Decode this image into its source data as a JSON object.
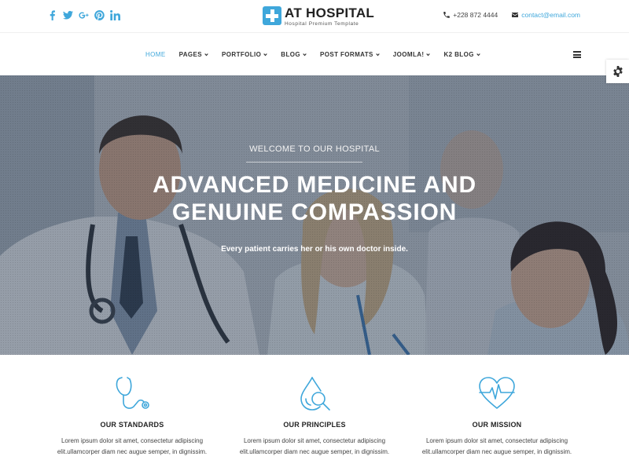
{
  "social": [
    "facebook-icon",
    "twitter-icon",
    "google-plus-icon",
    "pinterest-icon",
    "linkedin-icon"
  ],
  "logo": {
    "title": "AT HOSPITAL",
    "subtitle": "Hospital Premium Template"
  },
  "contact": {
    "phone": "+228 872 4444",
    "email": "contact@email.com"
  },
  "nav": {
    "items": [
      {
        "label": "HOME",
        "active": true,
        "dropdown": false
      },
      {
        "label": "PAGES",
        "active": false,
        "dropdown": true
      },
      {
        "label": "PORTFOLIO",
        "active": false,
        "dropdown": true
      },
      {
        "label": "BLOG",
        "active": false,
        "dropdown": true
      },
      {
        "label": "POST FORMATS",
        "active": false,
        "dropdown": true
      },
      {
        "label": "JOOMLA!",
        "active": false,
        "dropdown": true
      },
      {
        "label": "K2 BLOG",
        "active": false,
        "dropdown": true
      }
    ]
  },
  "hero": {
    "kicker": "WELCOME TO OUR HOSPITAL",
    "title_line1": "ADVANCED MEDICINE AND",
    "title_line2": "GENUINE COMPASSION",
    "subtitle": "Every patient carries her or his own doctor inside."
  },
  "features": [
    {
      "icon": "stethoscope-icon",
      "title": "OUR STANDARDS",
      "text_line1": "Lorem ipsum dolor sit amet, consectetur adipiscing",
      "text_line2": "elit.ullamcorper diam nec augue semper, in dignissim."
    },
    {
      "icon": "drop-magnifier-icon",
      "title": "OUR PRINCIPLES",
      "text_line1": "Lorem ipsum dolor sit amet, consectetur adipiscing",
      "text_line2": "elit.ullamcorper diam nec augue semper, in dignissim."
    },
    {
      "icon": "heart-pulse-icon",
      "title": "OUR MISSION",
      "text_line1": "Lorem ipsum dolor sit amet, consectetur adipiscing",
      "text_line2": "elit.ullamcorper diam nec augue semper, in dignissim."
    }
  ],
  "colors": {
    "accent": "#3fa7db",
    "text": "#222222"
  }
}
